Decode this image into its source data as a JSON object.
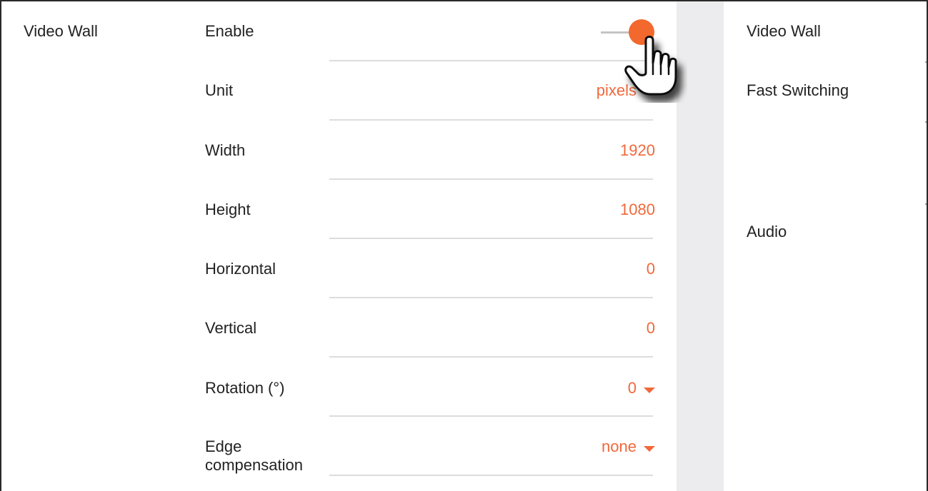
{
  "left_panel": {
    "section_title": "Video Wall",
    "enable": {
      "label": "Enable",
      "state": "on"
    },
    "unit": {
      "label": "Unit",
      "value": "pixels"
    },
    "width": {
      "label": "Width",
      "value": "1920"
    },
    "height": {
      "label": "Height",
      "value": "1080"
    },
    "horizontal": {
      "label": "Horizontal",
      "value": "0"
    },
    "vertical": {
      "label": "Vertical",
      "value": "0"
    },
    "rotation": {
      "label": "Rotation (°)",
      "value": "0"
    },
    "edge_compensation": {
      "label_line1": "Edge",
      "label_line2": "compensation",
      "value": "none"
    }
  },
  "right_panel": {
    "items": [
      "Video Wall",
      "Fast Switching",
      "Audio"
    ]
  },
  "colors": {
    "accent": "#f2683a",
    "toggle_knob": "#f2682d",
    "divider": "#dcdcdc",
    "gutter": "#ececee",
    "text": "#222222"
  },
  "icons": {
    "cursor": "pointing-hand-cursor",
    "dropdown": "caret-down-icon"
  }
}
